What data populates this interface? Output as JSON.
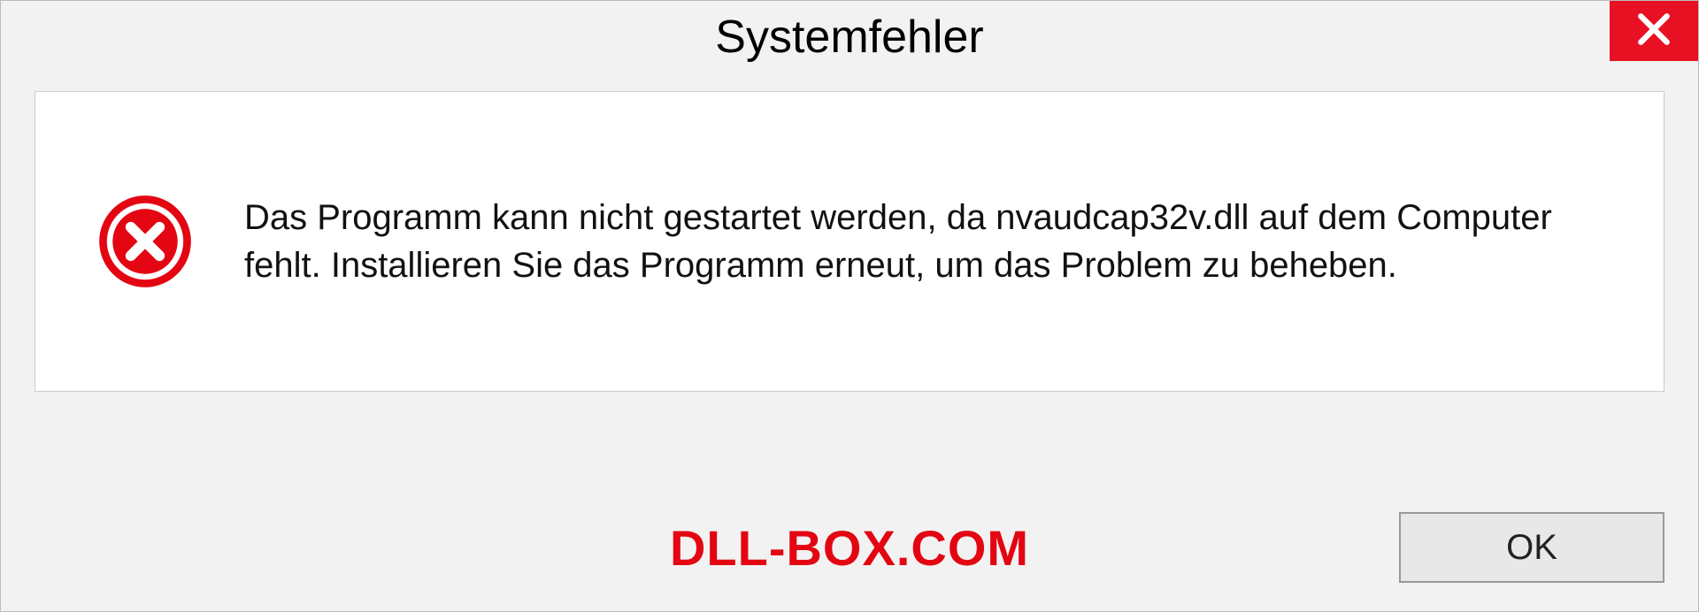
{
  "dialog": {
    "title": "Systemfehler",
    "message": "Das Programm kann nicht gestartet werden, da nvaudcap32v.dll auf dem Computer fehlt. Installieren Sie das Programm erneut, um das Problem zu beheben.",
    "ok_label": "OK",
    "watermark": "DLL-BOX.COM"
  },
  "colors": {
    "close_bg": "#e81123",
    "error_red": "#e30512"
  }
}
